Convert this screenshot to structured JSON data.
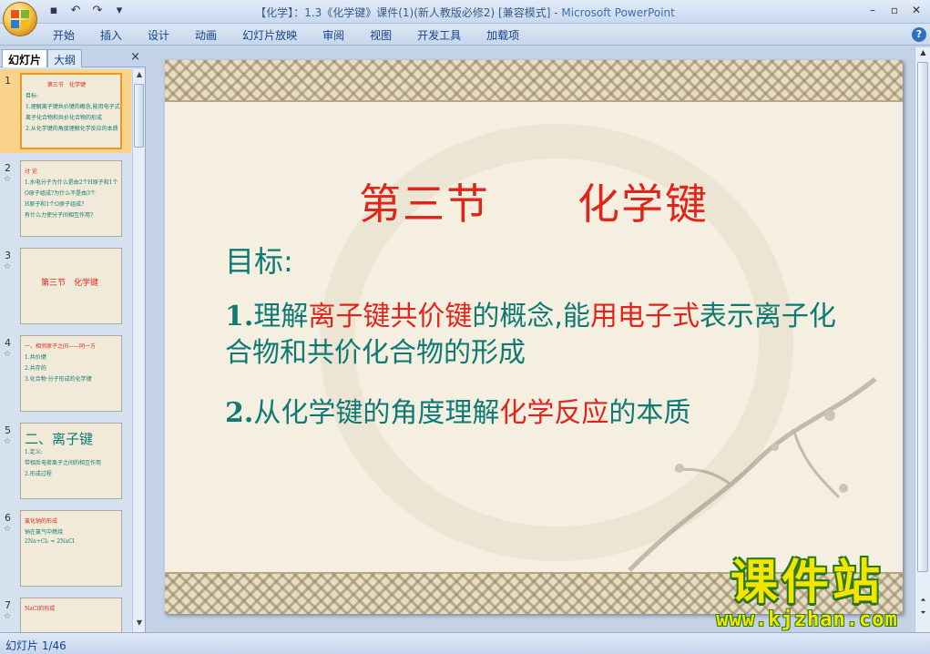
{
  "window": {
    "title": "【化学】：1.3《化学键》课件(1)(新人教版必修2) [兼容模式] - ",
    "app": "Microsoft PowerPoint"
  },
  "ribbon": {
    "tabs": [
      "开始",
      "插入",
      "设计",
      "动画",
      "幻灯片放映",
      "审阅",
      "视图",
      "开发工具",
      "加载项"
    ]
  },
  "left_pane": {
    "tab_slides": "幻灯片",
    "tab_outline": "大纲",
    "close": "×",
    "thumbnails": [
      {
        "num": "1",
        "lines": [
          "第三节　化学键",
          "目标:",
          "1.理解离子键共价键的概念,能用电子式表示",
          "离子化合物和共价化合物的形成",
          "2.从化学键的角度理解化学反应的本质"
        ]
      },
      {
        "num": "2",
        "lines": [
          "讨 论",
          "1.水电分子为什么是由2个H原子和1个",
          "O原子组成?为什么不是由3个",
          "H原子和1个O原子组成?",
          "有什么力使分子间相互作用?"
        ]
      },
      {
        "num": "3",
        "lines": [
          "第三节　化学键"
        ]
      },
      {
        "num": "4",
        "lines": [
          "一、相邻原子之间——同一方",
          "1.共价键",
          "2.共存的",
          "3.化合物·分子形成的化学键"
        ]
      },
      {
        "num": "5",
        "lines": [
          "二、离子键",
          "1.定义:",
          "带相反电荷离子之间的相互作用",
          "2.形成过程"
        ]
      },
      {
        "num": "6",
        "lines": [
          "氯化钠的形成",
          "钠在氯气中燃烧",
          "2Na+Cl₂ = 2NaCl"
        ]
      },
      {
        "num": "7",
        "lines": [
          "NaCl的形成"
        ]
      }
    ]
  },
  "slide": {
    "title": "第三节　　化学键",
    "goal": "目标:",
    "point1": {
      "num": "1.",
      "segments": [
        {
          "text": "理解",
          "red": false
        },
        {
          "text": "离子键共价键",
          "red": true
        },
        {
          "text": "的概念,能",
          "red": false
        },
        {
          "text": "用电子式",
          "red": true
        },
        {
          "text": "表示离子化合物和共价化合物的形成",
          "red": false
        }
      ]
    },
    "point2": {
      "num": "2.",
      "segments": [
        {
          "text": "从化学键的角度理解",
          "red": false
        },
        {
          "text": "化学",
          "red": true
        },
        {
          "text": "反应",
          "red": true
        },
        {
          "text": "的本质",
          "red": false
        }
      ]
    }
  },
  "status": {
    "slide_indicator": "幻灯片 1/46"
  },
  "watermark": {
    "name": "课件站",
    "url": "www.kjzhan.com"
  },
  "colors": {
    "accent_red": "#e0261b",
    "teal_text": "#0f7a74",
    "ribbon_text": "#15428b"
  }
}
